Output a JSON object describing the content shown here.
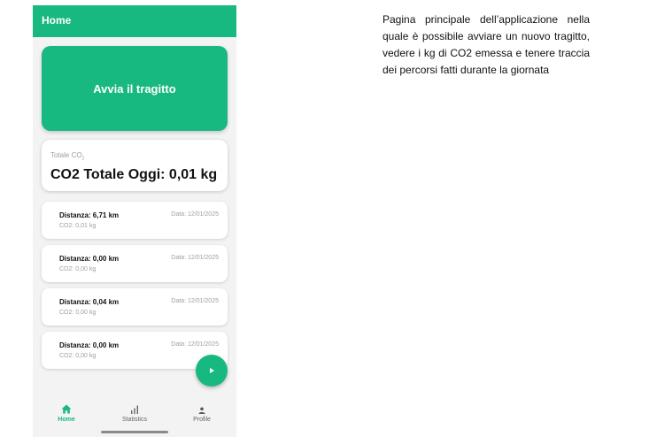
{
  "app": {
    "title": "Home",
    "start_button_label": "Avvia il tragitto",
    "total": {
      "label_text": "Totale CO",
      "label_subscript": "2",
      "value": "CO2 Totale Oggi: 0,01 kg"
    },
    "trips": [
      {
        "distance": "Distanza: 6,71 km",
        "co2": "CO2: 0,01 kg",
        "date": "Data: 12/01/2025"
      },
      {
        "distance": "Distanza: 0,00 km",
        "co2": "CO2: 0,00 kg",
        "date": "Data: 12/01/2025"
      },
      {
        "distance": "Distanza: 0,04 km",
        "co2": "CO2: 0,00 kg",
        "date": "Data: 12/01/2025"
      },
      {
        "distance": "Distanza: 0,00 km",
        "co2": "CO2: 0,00 kg",
        "date": "Data: 12/01/2025"
      }
    ],
    "fab_icon": "play-icon",
    "nav": [
      {
        "label": "Home",
        "icon": "home-icon",
        "active": true
      },
      {
        "label": "Statistics",
        "icon": "bar-chart-icon",
        "active": false
      },
      {
        "label": "Profile",
        "icon": "person-icon",
        "active": false
      }
    ]
  },
  "description": "Pagina principale dell’applicazione nella quale è possibile avviare un nuovo tragitto, vedere i kg di CO2 emessa e tenere traccia dei percorsi fatti durante la giornata",
  "colors": {
    "primary": "#17b981",
    "background": "#f3f3f3",
    "muted_text": "#9e9e9e"
  }
}
